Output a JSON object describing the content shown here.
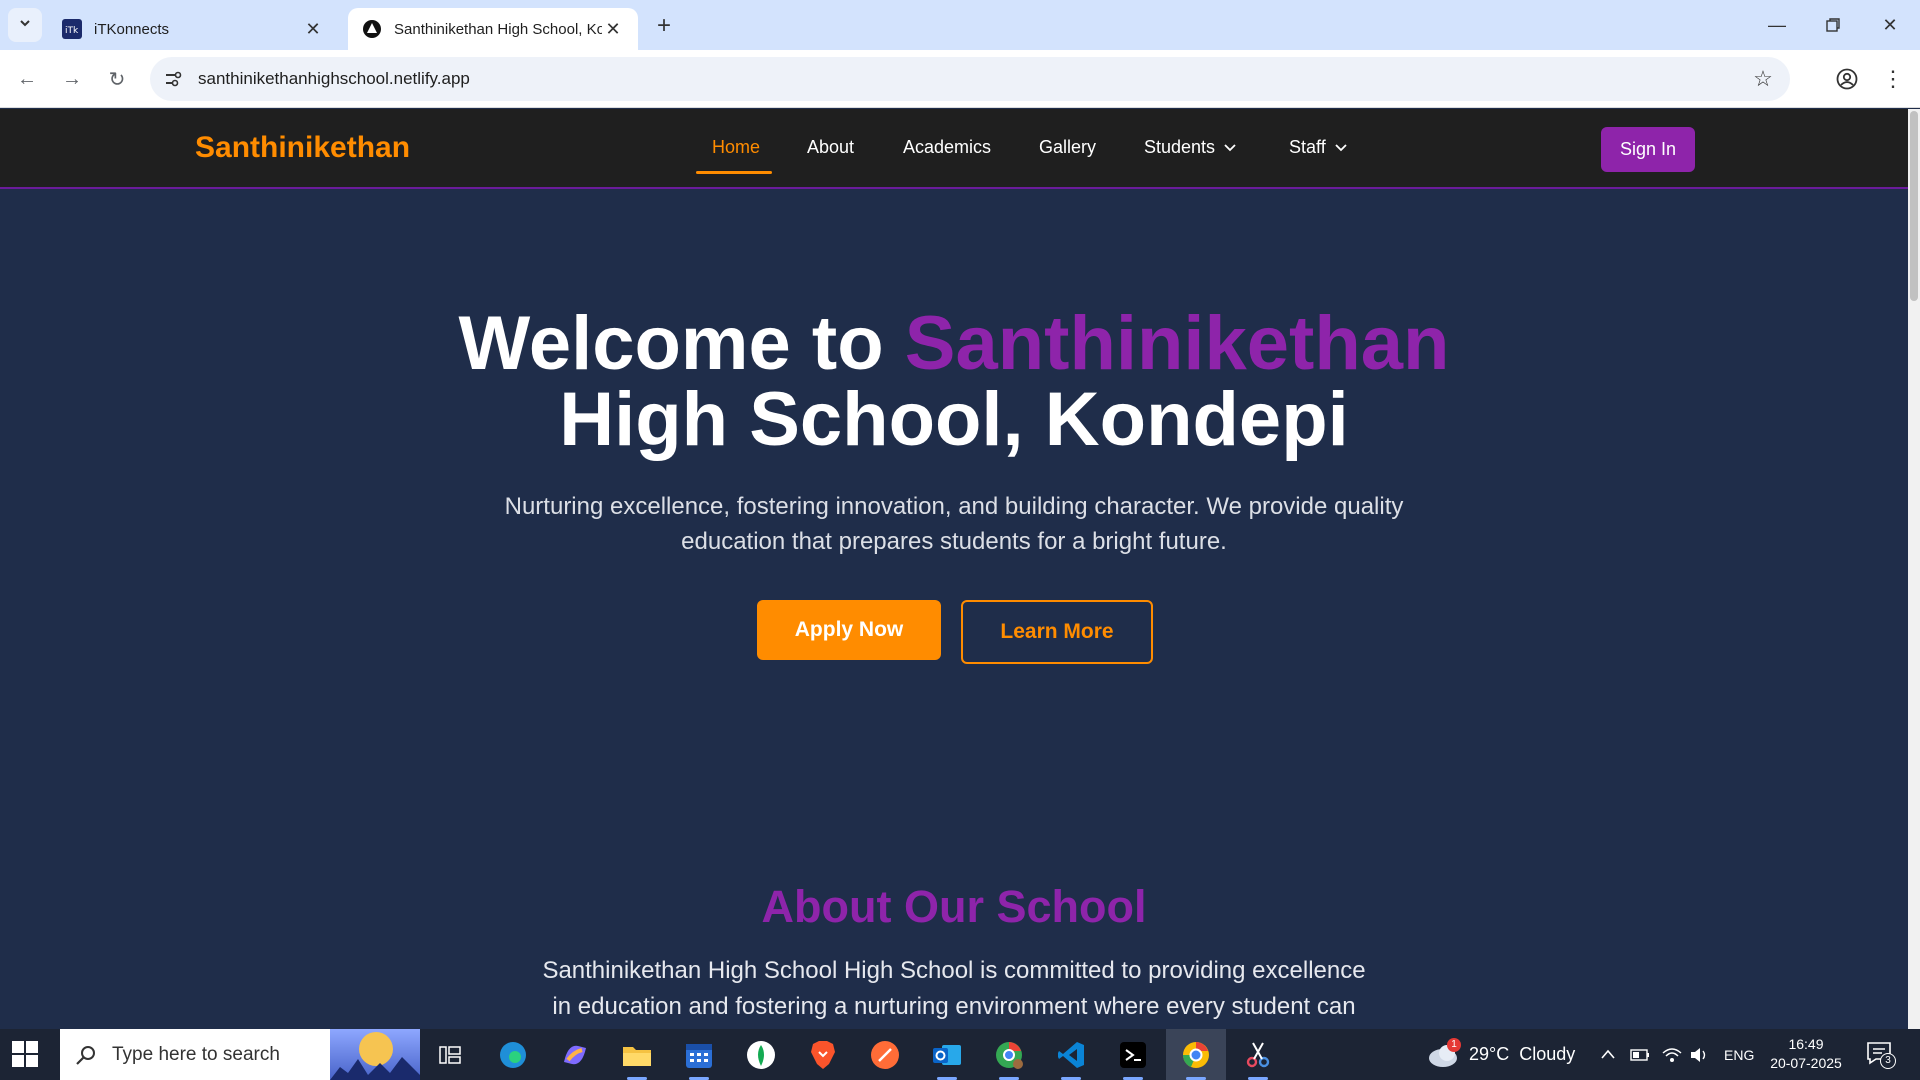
{
  "browser": {
    "tabs": [
      {
        "title": "iTKonnects",
        "active": false
      },
      {
        "title": "Santhinikethan High School, Ko",
        "active": true
      }
    ],
    "url": "santhinikethanhighschool.netlify.app"
  },
  "site": {
    "brand": "Santhinikethan",
    "nav": [
      {
        "label": "Home",
        "active": true
      },
      {
        "label": "About"
      },
      {
        "label": "Academics"
      },
      {
        "label": "Gallery"
      },
      {
        "label": "Students",
        "dropdown": true
      },
      {
        "label": "Staff",
        "dropdown": true
      }
    ],
    "sign_in": "Sign In",
    "hero": {
      "title_prefix": "Welcome to ",
      "title_accent": "Santhinikethan",
      "title_line2": "High School, Kondepi",
      "subtitle": "Nurturing excellence, fostering innovation, and building character. We provide quality education that prepares students for a bright future.",
      "apply_label": "Apply Now",
      "learn_label": "Learn More"
    },
    "about": {
      "title": "About Our School",
      "text": "Santhinikethan High School High School is committed to providing excellence in education and fostering a nurturing environment where every student can thrive."
    },
    "colors": {
      "accent_orange": "#ff8c00",
      "accent_purple": "#8e24aa",
      "background": "#1f2d4a",
      "nav_bg": "#1f1f1f"
    }
  },
  "taskbar": {
    "search_placeholder": "Type here to search",
    "weather": "29°C  Cloudy",
    "weather_badge": "1",
    "language": "ENG",
    "time": "16:49",
    "date": "20-07-2025",
    "notifications": "3",
    "apps": [
      "task-view-icon",
      "edge-icon",
      "copilot-icon",
      "file-explorer-icon",
      "calendar-icon",
      "mongodb-icon",
      "brave-icon",
      "postman-icon",
      "outlook-icon",
      "chrome-profile-icon",
      "vscode-icon",
      "terminal-icon",
      "chrome-icon",
      "snipping-tool-icon"
    ]
  }
}
